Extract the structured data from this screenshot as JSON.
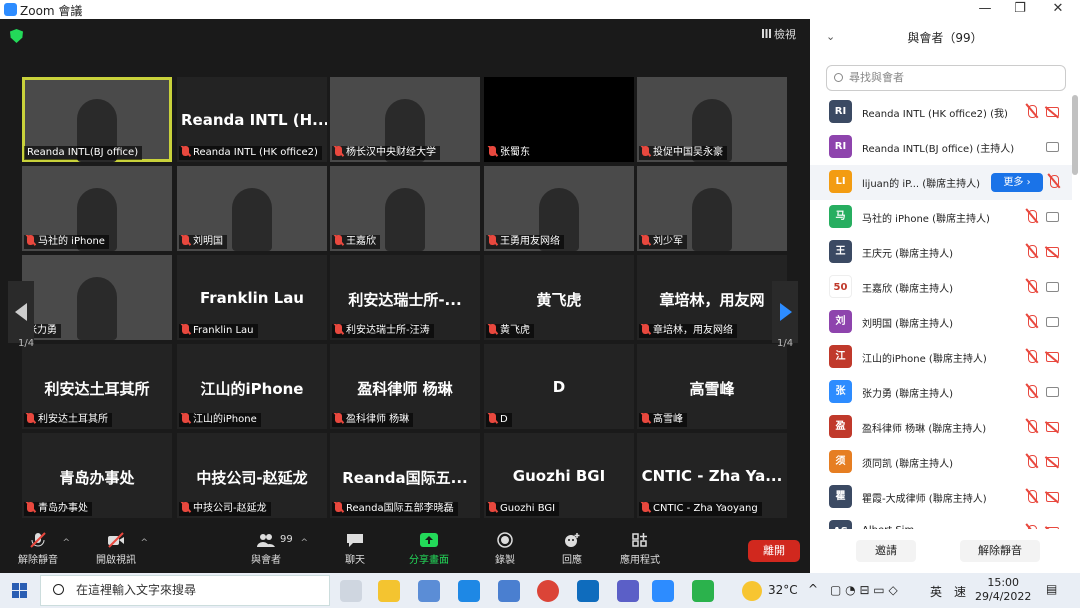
{
  "window": {
    "title": "Zoom 會議",
    "min": "—",
    "max": "❐",
    "close": "✕"
  },
  "view_button": "檢視",
  "tiles": [
    {
      "label": "Reanda INTL(BJ office)",
      "name": "",
      "kind": "video",
      "active": true,
      "muted": false
    },
    {
      "label": "Reanda INTL (HK office2)",
      "name": "Reanda INTL (H...",
      "kind": "text",
      "muted": true
    },
    {
      "label": "杨长汉中央财经大学",
      "name": "",
      "kind": "video",
      "muted": true
    },
    {
      "label": "张蜀东",
      "name": "",
      "kind": "black",
      "muted": true
    },
    {
      "label": "投促中国吴永豪",
      "name": "",
      "kind": "video",
      "muted": true
    },
    {
      "label": "马社的 iPhone",
      "name": "",
      "kind": "video",
      "muted": true
    },
    {
      "label": "刘明国",
      "name": "",
      "kind": "video",
      "muted": true
    },
    {
      "label": "王嘉欣",
      "name": "",
      "kind": "video",
      "muted": true
    },
    {
      "label": "王勇用友网络",
      "name": "",
      "kind": "video",
      "muted": true
    },
    {
      "label": "刘少军",
      "name": "",
      "kind": "video",
      "muted": true
    },
    {
      "label": "张力勇",
      "name": "",
      "kind": "video",
      "muted": false
    },
    {
      "label": "Franklin Lau",
      "name": "Franklin Lau",
      "kind": "text",
      "muted": true
    },
    {
      "label": "利安达瑞士所-汪涛",
      "name": "利安达瑞士所-...",
      "kind": "text",
      "muted": true
    },
    {
      "label": "黄飞虎",
      "name": "黄飞虎",
      "kind": "text",
      "muted": true
    },
    {
      "label": "章培林，用友网络",
      "name": "章培林，用友网",
      "kind": "text",
      "muted": true
    },
    {
      "label": "利安达土耳其所",
      "name": "利安达土耳其所",
      "kind": "text",
      "muted": true
    },
    {
      "label": "江山的iPhone",
      "name": "江山的iPhone",
      "kind": "text",
      "muted": true
    },
    {
      "label": "盈科律师 杨琳",
      "name": "盈科律师 杨琳",
      "kind": "text",
      "muted": true
    },
    {
      "label": "D",
      "name": "D",
      "kind": "text",
      "muted": true
    },
    {
      "label": "高雪峰",
      "name": "高雪峰",
      "kind": "text",
      "muted": true
    },
    {
      "label": "青岛办事处",
      "name": "青岛办事处",
      "kind": "text",
      "muted": true
    },
    {
      "label": "中技公司-赵延龙",
      "name": "中技公司-赵延龙",
      "kind": "text",
      "muted": true
    },
    {
      "label": "Reanda国际五部李晓磊",
      "name": "Reanda国际五...",
      "kind": "text",
      "muted": true
    },
    {
      "label": "Guozhi BGI",
      "name": "Guozhi BGI",
      "kind": "text",
      "muted": true
    },
    {
      "label": "CNTIC - Zha Yaoyang",
      "name": "CNTIC - Zha Ya...",
      "kind": "text",
      "muted": true
    }
  ],
  "pager": {
    "left": "1/4",
    "right": "1/4"
  },
  "toolbar": {
    "unmute": "解除靜音",
    "video": "開啟視訊",
    "participants": "與會者",
    "participants_count": "99",
    "chat": "聊天",
    "share": "分享畫面",
    "record": "錄製",
    "reactions": "回應",
    "apps": "應用程式",
    "leave": "離開"
  },
  "panel": {
    "title": "與會者（99）",
    "search_placeholder": "尋找與會者",
    "more_button": "更多 ›",
    "invite": "邀請",
    "unmute_all": "解除靜音",
    "participants": [
      {
        "initials": "RI",
        "name": "Reanda INTL (HK office2) (我)",
        "color": "#3b4a63",
        "cam": "off"
      },
      {
        "initials": "RI",
        "name": "Reanda INTL(BJ office) (主持人)",
        "color": "#8e44ad",
        "cam": "on",
        "mic": "none"
      },
      {
        "initials": "LI",
        "name": "lijuan的 iP... (聯席主持人)",
        "color": "#f39c12",
        "cam": "off",
        "more": true
      },
      {
        "initials": "马",
        "name": "马社的 iPhone (聯席主持人)",
        "color": "#27ae60",
        "cam": "on"
      },
      {
        "initials": "王",
        "name": "王庆元 (聯席主持人)",
        "color": "#3b4a63",
        "cam": "off"
      },
      {
        "initials": "50",
        "name": "王嘉欣 (聯席主持人)",
        "color": "#ffffff",
        "cam": "on"
      },
      {
        "initials": "刘",
        "name": "刘明国 (聯席主持人)",
        "color": "#8e44ad",
        "cam": "on"
      },
      {
        "initials": "江",
        "name": "江山的iPhone (聯席主持人)",
        "color": "#c0392b",
        "cam": "off"
      },
      {
        "initials": "张",
        "name": "张力勇 (聯席主持人)",
        "color": "#2d8cff",
        "cam": "on"
      },
      {
        "initials": "盈",
        "name": "盈科律师 杨琳 (聯席主持人)",
        "color": "#c0392b",
        "cam": "off"
      },
      {
        "initials": "须",
        "name": "须同凯 (聯席主持人)",
        "color": "#e67e22",
        "cam": "off"
      },
      {
        "initials": "瞿",
        "name": "瞿霞-大成律师 (聯席主持人)",
        "color": "#3b4a63",
        "cam": "off"
      },
      {
        "initials": "AS",
        "name": "Albert Sim...",
        "color": "#3b4a63",
        "cam": "off"
      }
    ]
  },
  "taskbar": {
    "search_placeholder": "在這裡輸入文字來搜尋",
    "weather": "32°C",
    "ime": "英",
    "ime2": "速",
    "time": "15:00",
    "date": "29/4/2022"
  }
}
